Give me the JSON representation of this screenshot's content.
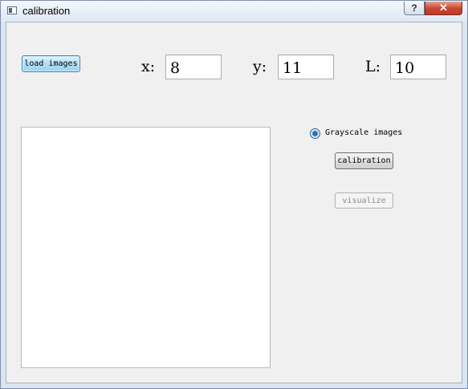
{
  "window": {
    "title": "calibration",
    "help_glyph": "?",
    "close_glyph": "✕",
    "icons": [
      "app-window-icon",
      "help-icon",
      "close-icon"
    ]
  },
  "toolbar": {
    "load_label": "load images"
  },
  "params": {
    "x": {
      "label": "x:",
      "value": "8"
    },
    "y": {
      "label": "y:",
      "value": "11"
    },
    "l": {
      "label": "L:",
      "value": "10"
    }
  },
  "options": {
    "grayscale_label": "Grayscale images",
    "grayscale_checked": true
  },
  "actions": {
    "calibration_label": "calibration",
    "visualize_label": "visualize",
    "visualize_enabled": false
  },
  "colors": {
    "accent_button": "#b0def5",
    "close_button": "#c8432c",
    "client_bg": "#f0f0f0"
  }
}
